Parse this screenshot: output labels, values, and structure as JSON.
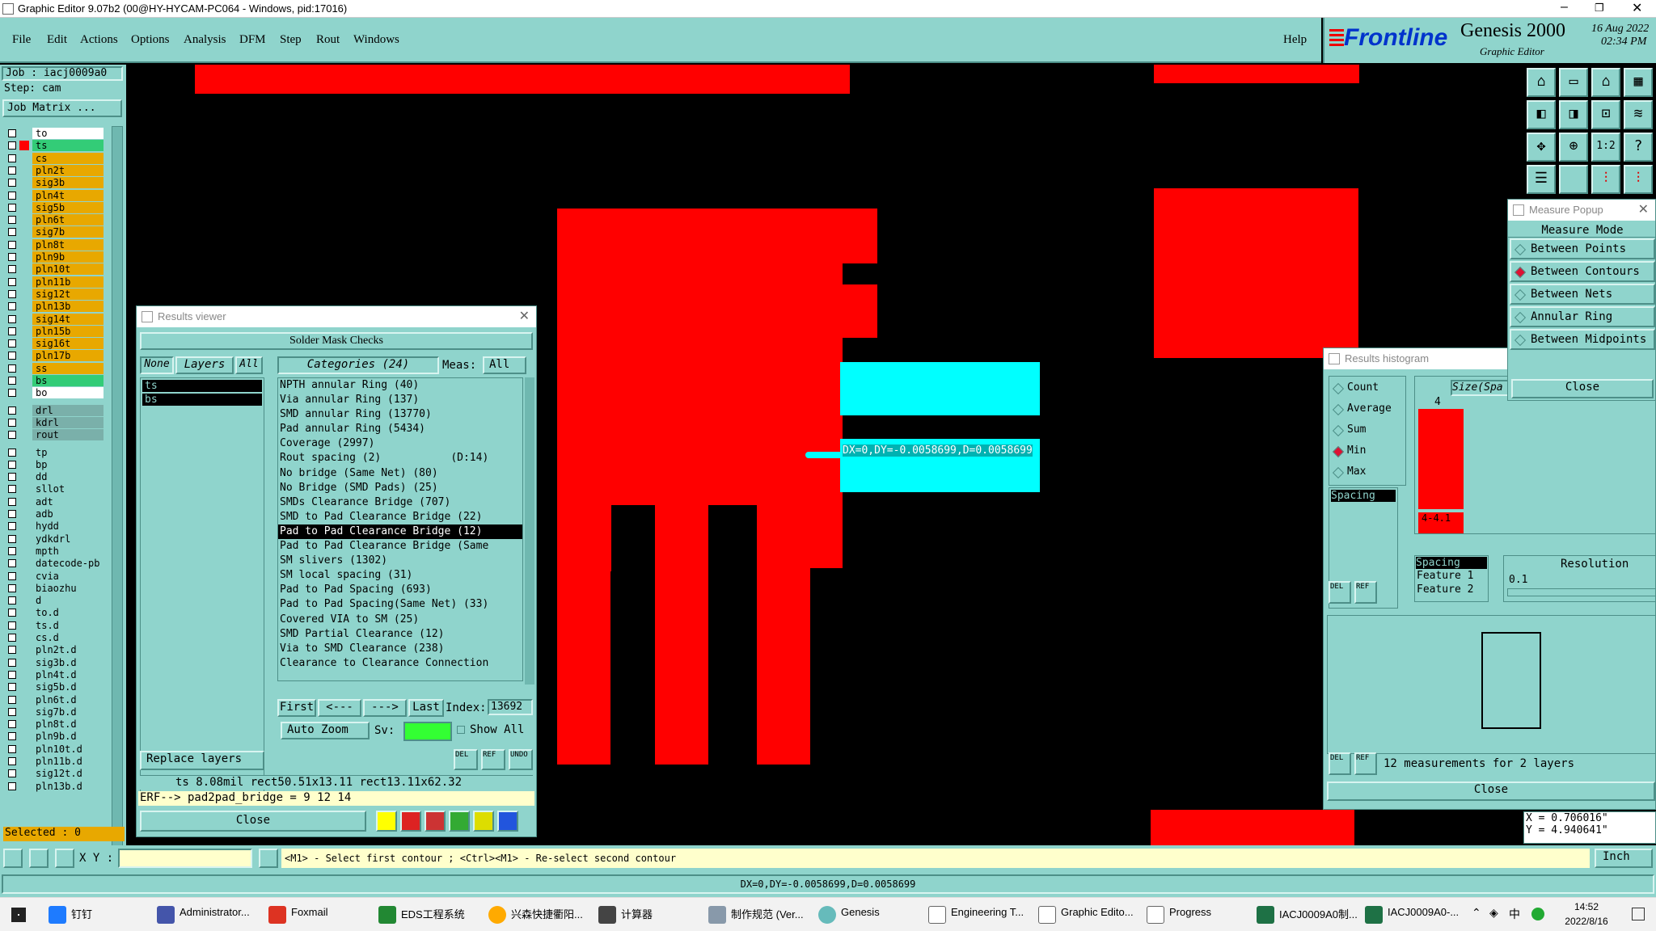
{
  "window": {
    "title": "Graphic Editor 9.07b2 (00@HY-HYCAM-PC064 - Windows, pid:17016)"
  },
  "menu": {
    "items": [
      "File",
      "Edit",
      "Actions",
      "Options",
      "Analysis",
      "DFM",
      "Step",
      "Rout",
      "Windows"
    ],
    "help": "Help"
  },
  "brand": {
    "logo": "Frontline",
    "product": "Genesis 2000",
    "subtitle": "Graphic Editor",
    "date": "16 Aug 2022",
    "time": "02:34 PM"
  },
  "left": {
    "job": "Job  : iacj0009a0",
    "step": "Step: cam",
    "job_matrix": "Job Matrix ...",
    "selected": "Selected : 0",
    "layers1": [
      "to",
      "ts",
      "cs",
      "pln2t",
      "sig3b",
      "pln4t",
      "sig5b",
      "pln6t",
      "sig7b",
      "pln8t",
      "pln9b",
      "pln10t",
      "pln11b",
      "sig12t",
      "pln13b",
      "sig14t",
      "pln15b",
      "sig16t",
      "pln17b",
      "ss",
      "bs",
      "bo"
    ],
    "layers2": [
      "drl",
      "kdrl",
      "rout"
    ],
    "layers3": [
      "tp",
      "bp",
      "dd",
      "sllot",
      "adt",
      "adb",
      "hydd",
      "ydkdrl",
      "mpth",
      "datecode-pb",
      "cvia",
      "biaozhu",
      "d",
      "to.d",
      "ts.d",
      "cs.d",
      "pln2t.d",
      "sig3b.d",
      "pln4t.d",
      "sig5b.d",
      "pln6t.d",
      "sig7b.d",
      "pln8t.d",
      "pln9b.d",
      "pln10t.d",
      "pln11b.d",
      "sig12t.d",
      "pln13b.d"
    ]
  },
  "canvas": {
    "measure_text": "DX=0,DY=-0.0058699,D=0.0058699"
  },
  "results": {
    "title": "Results viewer",
    "header": "Solder Mask Checks",
    "none": "None",
    "layers": "Layers",
    "all": "All",
    "categories": "Categories (24)",
    "meas_label": "Meas:",
    "meas_value": "All",
    "layer_list": [
      "ts",
      "bs"
    ],
    "items": [
      "NPTH annular Ring (40)",
      "Via annular Ring (137)",
      "SMD annular Ring (13770)",
      "Pad annular Ring (5434)",
      "Coverage (2997)",
      "Rout spacing (2)           (D:14)",
      "No bridge (Same Net) (80)",
      "No Bridge (SMD Pads) (25)",
      "SMDs Clearance Bridge (707)",
      "SMD to Pad Clearance Bridge (22)",
      "Pad to Pad Clearance Bridge (12)",
      "Pad to Pad Clearance Bridge (Same",
      "SM slivers (1302)",
      "SM local spacing (31)",
      "Pad to Pad Spacing (693)",
      "Pad to Pad Spacing(Same Net) (33)",
      "Covered VIA to SM (25)",
      "SMD Partial Clearance (12)",
      "Via to SMD Clearance (238)",
      "Clearance to Clearance Connection"
    ],
    "selected_index": 10,
    "first": "First",
    "prev": "<---",
    "next": "--->",
    "last": "Last",
    "index_label": "Index:",
    "index_value": "13692",
    "auto_zoom": "Auto Zoom",
    "sv": "Sv:",
    "show_all": "Show All",
    "replace_layers": "Replace layers",
    "info": "ts 8.08mil   rect50.51x13.11   rect13.11x62.32",
    "erf": "ERF--> pad2pad_bridge = 9 12 14",
    "close": "Close",
    "del": "DEL",
    "ref": "REF",
    "undo": "UNDO"
  },
  "measure": {
    "title": "Measure Popup",
    "mode": "Measure Mode",
    "options": [
      "Between Points",
      "Between Contours",
      "Between Nets",
      "Annular Ring",
      "Between Midpoints"
    ],
    "selected": 1,
    "close": "Close"
  },
  "histogram": {
    "title": "Results histogram",
    "stats": [
      "Count",
      "Average",
      "Sum",
      "Min",
      "Max"
    ],
    "selected_stat": 3,
    "size_label": "Size(Spa",
    "bar_top": "4",
    "bar_bottom": "4-4.1",
    "spacing": "Spacing",
    "list2": [
      "Spacing",
      "Feature 1",
      "Feature 2"
    ],
    "resolution": "Resolution",
    "res_value": "0.1",
    "summary": "12 measurements for 2 layers",
    "close": "Close"
  },
  "coords": {
    "x": "X = 0.706016\"",
    "y": "Y = 4.940641\""
  },
  "status": {
    "xy": "X Y :",
    "prompt": "<M1> - Select first contour ; <Ctrl><M1> - Re-select second contour",
    "units": "Inch",
    "bottom": "DX=0,DY=-0.0058699,D=0.0058699"
  },
  "taskbar": {
    "items": [
      "钉钉",
      "Administrator...",
      "Foxmail",
      "EDS工程系统",
      "兴森快捷衢阳...",
      "计算器",
      "制作规范 (Ver...",
      "Genesis",
      "Engineering T...",
      "Graphic Edito...",
      "Progress",
      "IACJ0009A0制...",
      "IACJ0009A0-..."
    ],
    "ime": "中",
    "time": "14:52",
    "date": "2022/8/16"
  },
  "colors": {
    "teal": "#8fd4cc",
    "red": "#ff0000",
    "cyan": "#00ffff",
    "layer_orange": "#e8a800",
    "layer_green": "#33cc77"
  }
}
